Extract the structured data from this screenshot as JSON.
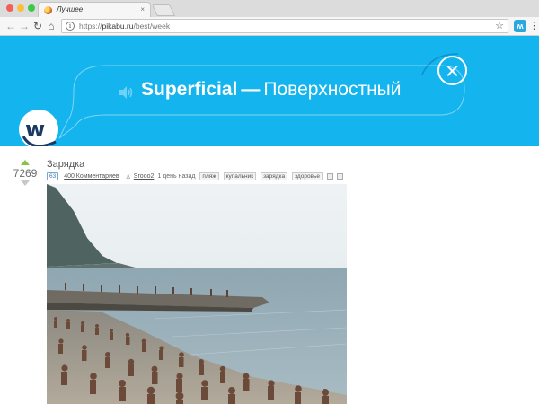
{
  "browser": {
    "tab_title": "Лучшее",
    "tab_close": "×",
    "url_scheme": "https://",
    "url_host": "pikabu.ru",
    "url_path": "/best/week",
    "back_glyph": "←",
    "forward_glyph": "→",
    "reload_glyph": "↻",
    "home_glyph": "⌂",
    "star_glyph": "☆",
    "menu_glyph": "⋮",
    "ext_glyph": "ʍ"
  },
  "banner": {
    "word_en": "Superficial",
    "dash": "—",
    "word_ru": "Поверхностный",
    "bg_color": "#14b4ee",
    "logo_letter": "w"
  },
  "post": {
    "rating": "7269",
    "title": "Зарядка",
    "comment_badge": "63",
    "comments_link": "400 Комментариев",
    "user_icon": "♙",
    "author": "Srooo2",
    "time": "1 день назад",
    "tags": [
      "пляж",
      "купальник",
      "зарядка",
      "здоровье"
    ],
    "upvote_color": "#8bc34a"
  }
}
